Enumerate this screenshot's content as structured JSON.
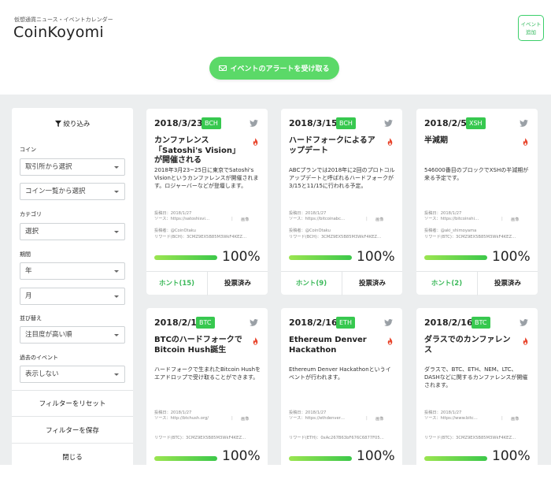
{
  "header": {
    "tagline": "仮想通貨ニュース・イベントカレンダー",
    "logo": "CoinKoyomi",
    "add_event_line1": "イベント",
    "add_event_line2": "追加",
    "alert_button": "イベントのアラートを受け取る"
  },
  "sidebar": {
    "title": "絞り込み",
    "coin_label": "コイン",
    "exchange_select": "取引所から選択",
    "coinlist_select": "コイン一覧から選択",
    "category_label": "カテゴリ",
    "category_select": "選択",
    "period_label": "期間",
    "year_select": "年",
    "month_select": "月",
    "sort_label": "並び替え",
    "sort_select": "注目度が高い順",
    "past_label": "過去のイベント",
    "past_select": "表示しない",
    "reset_button": "フィルターをリセット",
    "save_button": "フィルターを保存",
    "close_button": "閉じる"
  },
  "cards": [
    {
      "date": "2018/3/23",
      "ticker": "BCH",
      "title": "カンファレンス「Satoshi's Vision」が開催される",
      "desc": "2018年3月23~25日に東京でSatoshi's Visionというカンファレンスが開催されます。ロジャーバーなどが登壇します。",
      "posted": "投稿日：2018/1/27",
      "source": "ソース：https://satoshisvi…",
      "image": "画像",
      "poster": "投稿者：@CoinOtaku",
      "reward": "リワード(BCH)：3CMZ9EX5B85M3WkF4KEZ…",
      "percent": "100%",
      "progress": 1.0,
      "hont": "ホント(15)",
      "voted": "投票済み"
    },
    {
      "date": "2018/3/15",
      "ticker": "BCH",
      "title": "ハードフォークによるアップデート",
      "desc": "ABCプランでは2018年に2回のプロトコルアップデートと呼ばれるハードフォークが3/15と11/15に行われる予定。",
      "posted": "投稿日：2018/1/27",
      "source": "ソース：https://bitcoinabc…",
      "image": "画像",
      "poster": "投稿者：@CoinOtaku",
      "reward": "リワード(BCH)：3CMZ9EX5B85M3WkF4KEZ…",
      "percent": "100%",
      "progress": 1.0,
      "hont": "ホント(9)",
      "voted": "投票済み"
    },
    {
      "date": "2018/2/5",
      "ticker": "XSH",
      "title": "半減期",
      "desc": "546000番目のブロックでXSHの半減期が来る予定です。",
      "posted": "投稿日：2018/1/27",
      "source": "ソース：https://bitcoinshi…",
      "image": "画像",
      "poster": "投稿者：@aki_shimoyama",
      "reward": "リワード(BTC)：3CMZ9EX5B85M3WkF4KEZ…",
      "percent": "100%",
      "progress": 1.0,
      "hont": "ホント(2)",
      "voted": "投票済み"
    },
    {
      "date": "2018/2/1",
      "ticker": "BTC",
      "title": "BTCのハードフォークでBitcoin Hush誕生",
      "desc": "ハードフォークで生まれたBitcoin Hushをエアドロップで受け取ることができます。",
      "posted": "投稿日：2018/1/27",
      "source": "ソース：http://btchush.org/",
      "image": "画像",
      "poster": "",
      "reward": "リワード(BTC)：3CMZ9EX5B85M3WkF4KEZ…",
      "percent": "100%",
      "progress": 1.0,
      "hont": "",
      "voted": ""
    },
    {
      "date": "2018/2/16",
      "ticker": "ETH",
      "title": "Ethereum Denver Hackathon",
      "desc": "Ethereum Denver Hackathonというイベントが行われます。",
      "posted": "投稿日：2018/1/27",
      "source": "ソース：https://ethdenver…",
      "image": "画像",
      "poster": "",
      "reward": "リワード(ETH)：0xAc267B63bF676C6877F05…",
      "percent": "100%",
      "progress": 1.0,
      "hont": "",
      "voted": ""
    },
    {
      "date": "2018/2/16",
      "ticker": "BTC",
      "title": "ダラスでのカンファレンス",
      "desc": "ダラスで、BTC、ETH、NEM、LTC、DASHなどに関するカンファレンスが開催されます。",
      "posted": "投稿日：2018/1/27",
      "source": "ソース：https://www.bitc…",
      "image": "画像",
      "poster": "",
      "reward": "リワード(BTC)：3CMZ9EX5B85M3WkF4KEZ…",
      "percent": "100%",
      "progress": 1.0,
      "hont": "",
      "voted": ""
    }
  ],
  "colors": {
    "accent": "#3cc84a",
    "badge": "#37c84f",
    "background": "#eceeef"
  }
}
